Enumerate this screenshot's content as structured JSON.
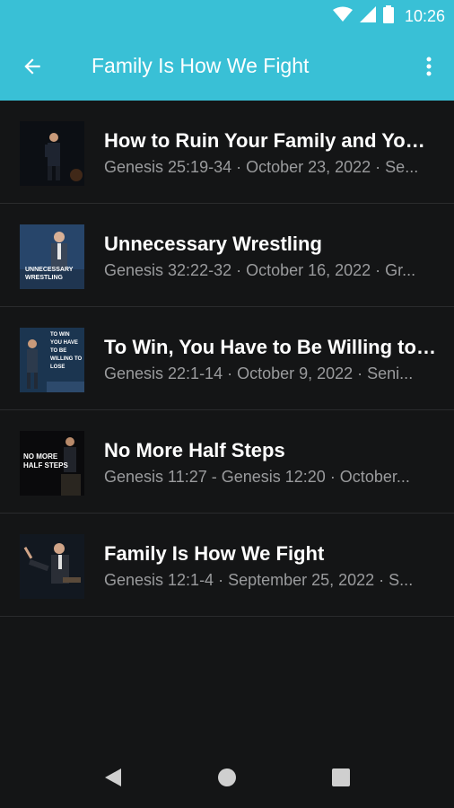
{
  "status_bar": {
    "time": "10:26",
    "icons": [
      "wifi-icon",
      "signal-icon",
      "battery-icon"
    ]
  },
  "app_bar": {
    "title": "Family Is How We Fight",
    "back_icon": "arrow-back-icon",
    "menu_icon": "more-vert-icon",
    "color": "#39c0d6"
  },
  "sermons": [
    {
      "title": "How to Ruin Your Family and Your Life",
      "subtitle": "Genesis 25:19-34 · October 23, 2022 · Se...",
      "thumb_text": []
    },
    {
      "title": "Unnecessary Wrestling",
      "subtitle": "Genesis 32:22-32 · October 16, 2022 · Gr...",
      "thumb_text": [
        "UNNECESSARY",
        "WRESTLING"
      ]
    },
    {
      "title": "To Win, You Have to Be Willing to Lose",
      "subtitle": "Genesis 22:1-14 · October 9, 2022 · Seni...",
      "thumb_text": [
        "TO WIN",
        "YOU HAVE",
        "TO BE",
        "WILLING TO",
        "LOSE"
      ]
    },
    {
      "title": "No More Half Steps",
      "subtitle": "Genesis 11:27 - Genesis 12:20 · October...",
      "thumb_text": [
        "NO MORE",
        "HALF STEPS"
      ]
    },
    {
      "title": "Family Is How We Fight",
      "subtitle": "Genesis 12:1-4 · September 25, 2022 · S...",
      "thumb_text": []
    }
  ],
  "nav_bar": {
    "icons": [
      "back-triangle-icon",
      "home-circle-icon",
      "recents-square-icon"
    ]
  }
}
